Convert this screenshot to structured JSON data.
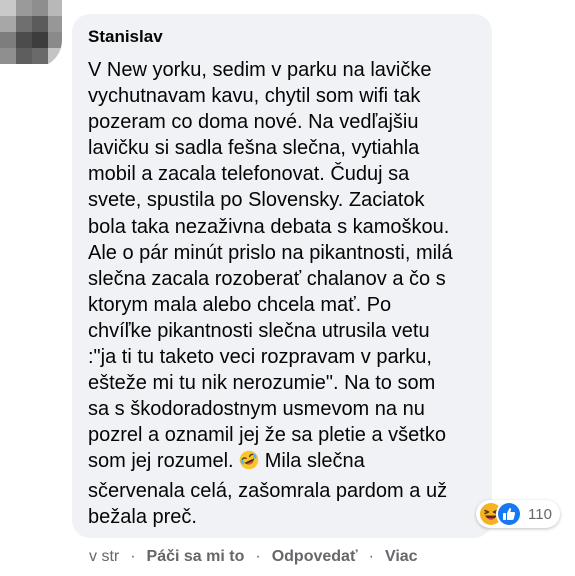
{
  "comment": {
    "author": "Stanislav",
    "text_before_emoji": "V New yorku, sedim v parku na lavičke vychutnavam kavu, chytil som wifi tak pozeram co doma nové. Na vedľajšiu lavičku si sadla fešna slečna, vytiahla mobil a zacala telefonovat. Čuduj sa svete, spustila po Slovensky. Zaciatok bola taka nezaživna debata s kamoškou. Ale o pár minút prislo na pikantnosti, milá slečna zacala rozoberať chalanov a čo s ktorym mala alebo chcela mať. Po chvíľke pikantnosti slečna utrusila vetu :\"ja ti tu taketo veci rozpravam v parku, ešteže mi tu nik nerozumie\". Na to som sa s škodoradostnym usmevom na nu pozrel a oznamil jej že sa pletie a všetko som jej rozumel.",
    "inline_emoji": "rolling-on-floor-laughing",
    "text_after_emoji": "Mila slečna sčervenala celá, zašomrala pardom a už bežala preč.",
    "reactions": {
      "icons": [
        "haha-icon",
        "like-icon"
      ],
      "count": "110"
    }
  },
  "actions": {
    "time": "v str",
    "like": "Páči sa mi to",
    "reply": "Odpovedať",
    "more": "Viac"
  },
  "colors": {
    "bubble": "#f0f2f5",
    "text": "#050505",
    "secondary": "#65676b",
    "like_blue": "#1877f2",
    "haha_yellow": "#f7b125"
  }
}
